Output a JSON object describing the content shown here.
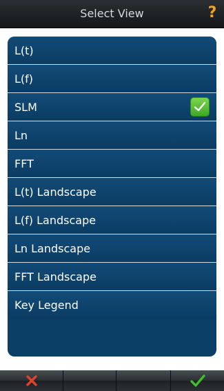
{
  "header": {
    "title": "Select View",
    "help_icon": "question-mark-icon",
    "help_color": "#f5a21c"
  },
  "views": {
    "selected": "SLM",
    "items": [
      {
        "label": "L(t)"
      },
      {
        "label": "L(f)"
      },
      {
        "label": "SLM",
        "checked": true
      },
      {
        "label": "Ln"
      },
      {
        "label": "FFT"
      },
      {
        "label": "L(t) Landscape"
      },
      {
        "label": "L(f) Landscape"
      },
      {
        "label": "Ln Landscape"
      },
      {
        "label": "FFT Landscape"
      },
      {
        "label": "Key Legend"
      }
    ]
  },
  "toolbar": {
    "cancel_icon": "x-icon",
    "confirm_icon": "checkmark-icon",
    "cancel_color": "#e0432a",
    "confirm_color": "#3fbf2a"
  },
  "colors": {
    "list_bg": "#0c3f66",
    "check_bg": "#52c03a"
  }
}
